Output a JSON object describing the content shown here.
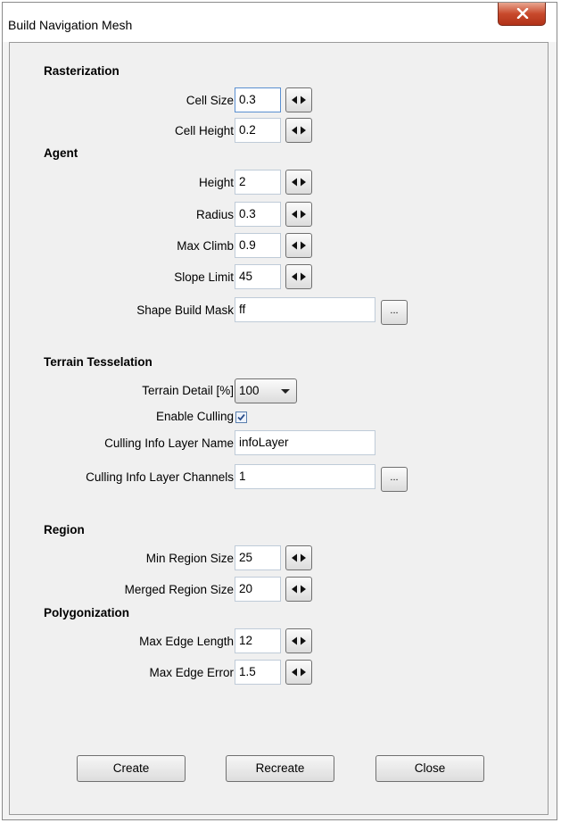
{
  "window": {
    "title": "Build Navigation Mesh"
  },
  "rasterization": {
    "header": "Rasterization",
    "cell_size": {
      "label": "Cell Size",
      "value": "0.3"
    },
    "cell_height": {
      "label": "Cell Height",
      "value": "0.2"
    }
  },
  "agent": {
    "header": "Agent",
    "height": {
      "label": "Height",
      "value": "2"
    },
    "radius": {
      "label": "Radius",
      "value": "0.3"
    },
    "max_climb": {
      "label": "Max Climb",
      "value": "0.9"
    },
    "slope_limit": {
      "label": "Slope Limit",
      "value": "45"
    },
    "shape_build_mask": {
      "label": "Shape Build Mask",
      "value": "ff",
      "browse_label": "..."
    }
  },
  "terrain": {
    "header": "Terrain Tesselation",
    "detail": {
      "label": "Terrain Detail [%]",
      "value": "100"
    },
    "culling": {
      "label": "Enable Culling",
      "checked": true
    },
    "layer_name": {
      "label": "Culling Info Layer Name",
      "value": "infoLayer"
    },
    "layer_channels": {
      "label": "Culling Info Layer Channels",
      "value": "1",
      "browse_label": "..."
    }
  },
  "region": {
    "header": "Region",
    "min_size": {
      "label": "Min Region Size",
      "value": "25"
    },
    "merged_size": {
      "label": "Merged Region Size",
      "value": "20"
    }
  },
  "polygonization": {
    "header": "Polygonization",
    "max_edge_length": {
      "label": "Max Edge Length",
      "value": "12"
    },
    "max_edge_error": {
      "label": "Max Edge Error",
      "value": "1.5"
    }
  },
  "buttons": {
    "create": "Create",
    "recreate": "Recreate",
    "close": "Close"
  },
  "icons": {
    "close": "close-x-icon",
    "spin": "left-right-spin-icon",
    "check": "checkmark-icon",
    "dropdown": "chevron-down-icon"
  }
}
